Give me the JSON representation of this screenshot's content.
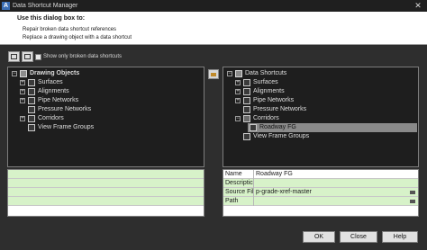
{
  "window": {
    "title": "Data Shortcut Manager",
    "app_logo": "A",
    "close_glyph": "✕"
  },
  "banner": {
    "heading": "Use this dialog box to:",
    "lines": [
      "Repair broken data shortcut references",
      "Replace a drawing object with a data shortcut"
    ]
  },
  "toolbar": {
    "checkbox_label": "Show only broken data shortcuts",
    "checkbox_checked": false
  },
  "left_tree": {
    "root": "Drawing Objects",
    "items": [
      "Surfaces",
      "Alignments",
      "Pipe Networks",
      "Pressure Networks",
      "Corridors",
      "View Frame Groups"
    ]
  },
  "right_tree": {
    "root": "Data Shortcuts",
    "items": [
      "Surfaces",
      "Alignments",
      "Pipe Networks",
      "Pressure Networks",
      "Corridors",
      "View Frame Groups"
    ],
    "corridor_child": "Roadway FG",
    "selected_item": "Roadway FG"
  },
  "properties": {
    "rows": [
      {
        "name": "Name",
        "value": "Roadway FG"
      },
      {
        "name": "Descriptic",
        "value": ""
      },
      {
        "name": "Source Fil",
        "value": "p-grade-xref-master"
      },
      {
        "name": "Path",
        "value": ""
      }
    ]
  },
  "buttons": {
    "ok": "OK",
    "close": "Close",
    "help": "Help"
  },
  "colors": {
    "grid_green": "#d7f2c9",
    "tree_bg": "#1e1e1e",
    "dialog_bg": "#2e2e2e",
    "title_bar": "#1f1f1f"
  }
}
